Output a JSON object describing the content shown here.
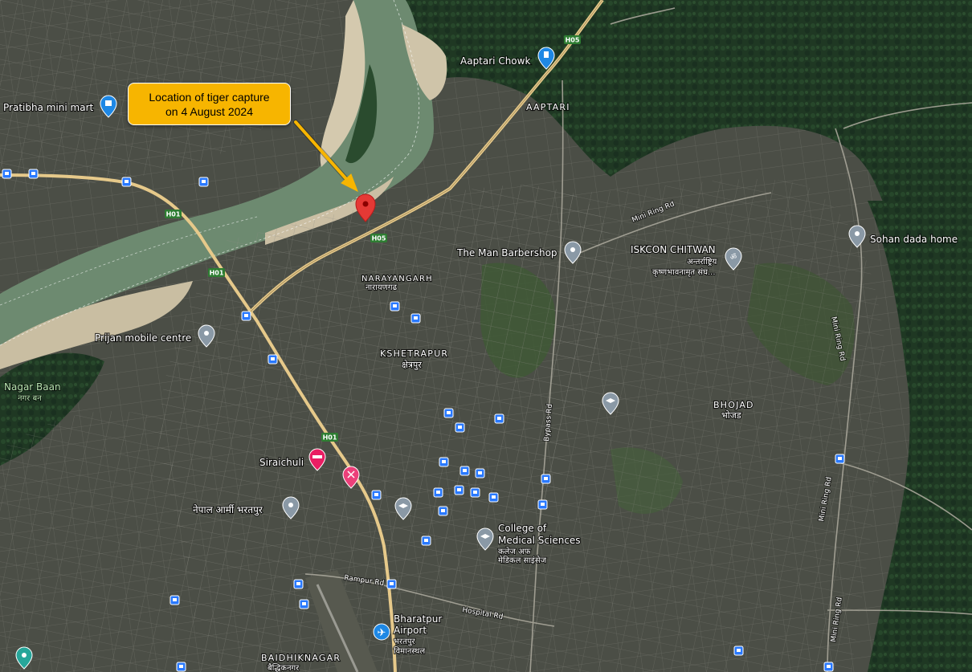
{
  "callout": {
    "line1": "Location of tiger capture",
    "line2": "on 4 August 2024",
    "color": "#f7b500"
  },
  "capture_marker": {
    "icon": "red-map-pin-icon",
    "color": "#e53935"
  },
  "places": {
    "pratibha": "Pratibha mini mart",
    "aaptari_chowk": "Aaptari Chowk",
    "aaptari": "AAPTARI",
    "narayangarh": "NARAYANGARH",
    "narayangarh_np": "नारायणगढ",
    "barbershop": "The Man Barbershop",
    "iskcon": "ISKCON CHITWAN",
    "iskcon_np1": "अन्तर्राष्ट्रिय",
    "iskcon_np2": "कृष्णभावनामृत संघ...",
    "sohan": "Sohan dada home",
    "prijan": "Prijan mobile centre",
    "nagar_baan": "Nagar Baan",
    "nagar_baan_np": "नगर बन",
    "kshetrapur": "KSHETRAPUR",
    "kshetrapur_np": "क्षेत्रपुर",
    "bhojad": "BHOJAD",
    "bhojad_np": "भोजड",
    "siraichuli": "Siraichuli",
    "army": "नेपाल आर्मी भरतपुर",
    "college1": "College of",
    "college2": "Medical Sciences",
    "college_np1": "कलेज अफ",
    "college_np2": "मेडिकल साइंसेज",
    "airport1": "Bharatpur",
    "airport2": "Airport",
    "airport_np1": "भरतपुर",
    "airport_np2": "विमानस्थल",
    "baidhiknagar": "BAIDHIKNAGAR",
    "baidhiknagar_np": "बैद्धिकनगर"
  },
  "roads": {
    "h05_a": "H05",
    "h05_b": "H05",
    "h01_a": "H01",
    "h01_b": "H01",
    "h01_c": "H01",
    "mini_ring_1": "Mini Ring Rd",
    "mini_ring_2": "Mini Ring Rd",
    "mini_ring_3": "Mini Ring Rd",
    "mini_ring_4": "Mini Ring Rd",
    "bypass": "Bypass Rd",
    "rampur": "Rampur Rd",
    "hospital": "Hospital Rd"
  },
  "colors": {
    "highway": "#e6c98a",
    "river": "#6f8a72",
    "sandbank": "#cfc3a6",
    "forest": "#1f3a24",
    "urban": "#4a4d45",
    "bus_stop": "#2979ff",
    "poi_gray": "#8a99a6"
  }
}
